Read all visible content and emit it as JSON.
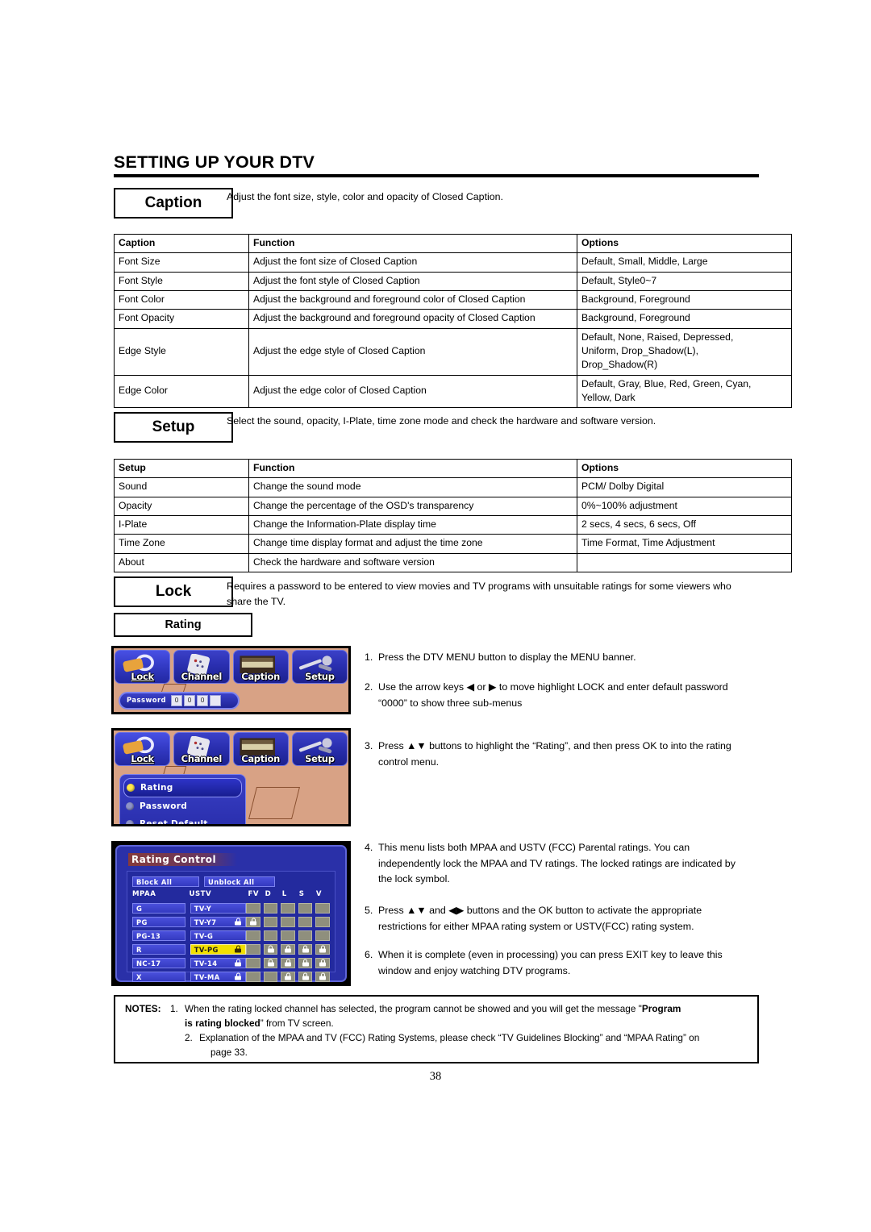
{
  "document": {
    "title": "SETTING UP YOUR DTV",
    "page_number": "38"
  },
  "caption_section": {
    "label": "Caption",
    "description": "Adjust the font size, style, color and opacity of Closed Caption.",
    "table": {
      "headers": [
        "Caption",
        "Function",
        "Options"
      ],
      "rows": [
        {
          "name": "Font Size",
          "function": "Adjust the font size of Closed Caption",
          "options": [
            "Default, Small, Middle, Large"
          ]
        },
        {
          "name": "Font Style",
          "function": "Adjust the font style of Closed Caption",
          "options": [
            "Default, Style0~7"
          ]
        },
        {
          "name": "Font Color",
          "function": "Adjust the background and foreground color of Closed Caption",
          "options": [
            "Background, Foreground"
          ]
        },
        {
          "name": "Font Opacity",
          "function": "Adjust the background and foreground opacity of Closed Caption",
          "options": [
            "Background, Foreground"
          ]
        },
        {
          "name": "Edge Style",
          "function": "Adjust the edge style of Closed Caption",
          "options": [
            "Default, None, Raised, Depressed,",
            "Uniform, Drop_Shadow(L),",
            "Drop_Shadow(R)"
          ]
        },
        {
          "name": "Edge Color",
          "function": "Adjust the edge color of Closed Caption",
          "options": [
            "Default, Gray, Blue, Red, Green, Cyan,",
            "Yellow, Dark"
          ]
        }
      ]
    }
  },
  "setup_section": {
    "label": "Setup",
    "description": "Select the sound, opacity, I-Plate, time zone mode and check the hardware and software version.",
    "table": {
      "headers": [
        "Setup",
        "Function",
        "Options"
      ],
      "rows": [
        {
          "name": "Sound",
          "function": "Change the sound mode",
          "options": [
            "PCM/ Dolby Digital"
          ]
        },
        {
          "name": "Opacity",
          "function": "Change the percentage of the OSD's transparency",
          "options": [
            "0%~100% adjustment"
          ]
        },
        {
          "name": "I-Plate",
          "function": "Change the Information-Plate display time",
          "options": [
            "2 secs, 4 secs, 6 secs, Off"
          ]
        },
        {
          "name": "Time Zone",
          "function": "Change time display format and adjust the time zone",
          "options": [
            "Time Format, Time Adjustment"
          ]
        },
        {
          "name": "About",
          "function": "Check the hardware and software version",
          "options": [
            ""
          ]
        }
      ]
    }
  },
  "lock_section": {
    "label": "Lock",
    "description": "Requires a password to be entered to view movies and TV programs with unsuitable ratings for some viewers who share the TV.",
    "rating_label": "Rating"
  },
  "screenshots": {
    "menu_banner": {
      "tiles": [
        {
          "label": "Lock",
          "icon": "padlock-icon",
          "active": true
        },
        {
          "label": "Channel",
          "icon": "remote-control-icon",
          "active": false
        },
        {
          "label": "Caption",
          "icon": "landscape-icon",
          "active": false
        },
        {
          "label": "Setup",
          "icon": "wrench-screwdriver-icon",
          "active": false
        }
      ],
      "password_label": "Password",
      "password_cells": [
        "0",
        "0",
        "0",
        ""
      ]
    },
    "lock_submenu": {
      "items": [
        {
          "label": "Rating",
          "selected": true
        },
        {
          "label": "Password",
          "selected": false
        },
        {
          "label": "Reset  Default",
          "selected": false
        }
      ]
    },
    "rating_control": {
      "title": "Rating Control",
      "block_all": "Block All",
      "unblock_all": "Unblock All",
      "col_mpaa": "MPAA",
      "col_ustv": "USTV",
      "content_cols": [
        "FV",
        "D",
        "L",
        "S",
        "V"
      ],
      "rows": [
        {
          "mpaa": "G",
          "ustv": "TV-Y",
          "ustv_locked": false,
          "highlight": false,
          "cells": [
            false,
            false,
            false,
            false,
            false
          ]
        },
        {
          "mpaa": "PG",
          "ustv": "TV-Y7",
          "ustv_locked": true,
          "highlight": false,
          "cells": [
            true,
            false,
            false,
            false,
            false
          ]
        },
        {
          "mpaa": "PG-13",
          "ustv": "TV-G",
          "ustv_locked": false,
          "highlight": false,
          "cells": [
            false,
            false,
            false,
            false,
            false
          ]
        },
        {
          "mpaa": "R",
          "ustv": "TV-PG",
          "ustv_locked": true,
          "highlight": true,
          "cells": [
            false,
            true,
            true,
            true,
            true
          ]
        },
        {
          "mpaa": "NC-17",
          "ustv": "TV-14",
          "ustv_locked": true,
          "highlight": false,
          "cells": [
            false,
            true,
            true,
            true,
            true
          ]
        },
        {
          "mpaa": "X",
          "ustv": "TV-MA",
          "ustv_locked": true,
          "highlight": false,
          "cells": [
            false,
            false,
            true,
            true,
            true
          ]
        }
      ]
    }
  },
  "instructions": [
    {
      "num": "1.",
      "lines": [
        "Press the DTV MENU button to display the MENU banner."
      ]
    },
    {
      "num": "2.",
      "lines": [
        "Use the arrow keys ◀ or ▶ to move highlight LOCK and enter default password",
        "“0000” to show three sub-menus"
      ]
    },
    {
      "num": "3.",
      "lines": [
        "Press ▲▼ buttons to highlight the “Rating”, and then press OK to into the rating",
        "control menu."
      ]
    },
    {
      "num": "4.",
      "lines": [
        "This menu lists both MPAA and USTV (FCC) Parental ratings. You can",
        "independently lock the MPAA and TV ratings. The locked ratings are indicated by",
        "the lock symbol."
      ]
    },
    {
      "num": "5.",
      "lines": [
        "Press ▲▼ and ◀▶ buttons and the OK button to activate the appropriate",
        "restrictions for either MPAA rating system or USTV(FCC) rating system."
      ]
    },
    {
      "num": "6.",
      "lines": [
        "When it is complete (even in processing) you can press EXIT key to leave this",
        "window and enjoy watching DTV programs."
      ]
    }
  ],
  "notes": {
    "lead": "NOTES:",
    "items": [
      {
        "num": "1.",
        "part1": "When the rating locked channel has selected, the program cannot be showed and you will get the message \"",
        "bold1": "Program",
        "bold2": "is rating blocked",
        "part2": "” from TV screen."
      },
      {
        "num": "2.",
        "line1": "Explanation of the MPAA and TV (FCC) Rating Systems, please check “TV Guidelines Blocking” and “MPAA Rating” on",
        "line2": "page 33."
      }
    ]
  }
}
